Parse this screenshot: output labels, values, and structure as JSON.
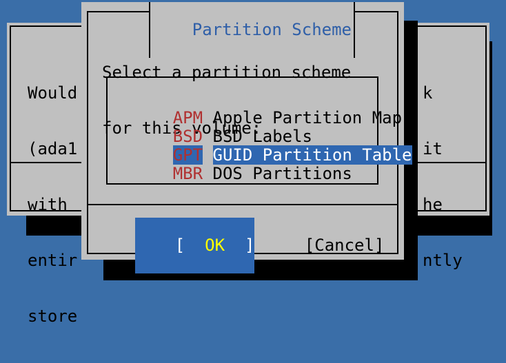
{
  "background_dialog": {
    "left_lines": [
      "Would",
      "(ada1",
      "with",
      "entir",
      "store"
    ],
    "right_lines": [
      "k",
      "it",
      "he",
      "ntly",
      ""
    ]
  },
  "dialog": {
    "title": "Partition Scheme",
    "prompt_line1": "Select a partition scheme",
    "prompt_line2": "for this volume:",
    "options": [
      {
        "key": "APM",
        "label": "Apple Partition Map",
        "selected": false
      },
      {
        "key": "BSD",
        "label": "BSD Labels",
        "selected": false
      },
      {
        "key": "GPT",
        "label": "GUID Partition Table",
        "selected": true
      },
      {
        "key": "MBR",
        "label": "DOS Partitions",
        "selected": false
      }
    ],
    "ok_left_bracket": "[",
    "ok_label": "OK",
    "ok_right_bracket": "]",
    "cancel_label": "[Cancel]"
  },
  "colors": {
    "desktop": "#3a6ea8",
    "dialog_bg": "#c0c0c0",
    "title": "#2f5fa8",
    "hotkey": "#b03030",
    "selection_bg": "#2f67b1",
    "selection_fg": "#ffffff",
    "ok_fg": "#ffff00"
  }
}
